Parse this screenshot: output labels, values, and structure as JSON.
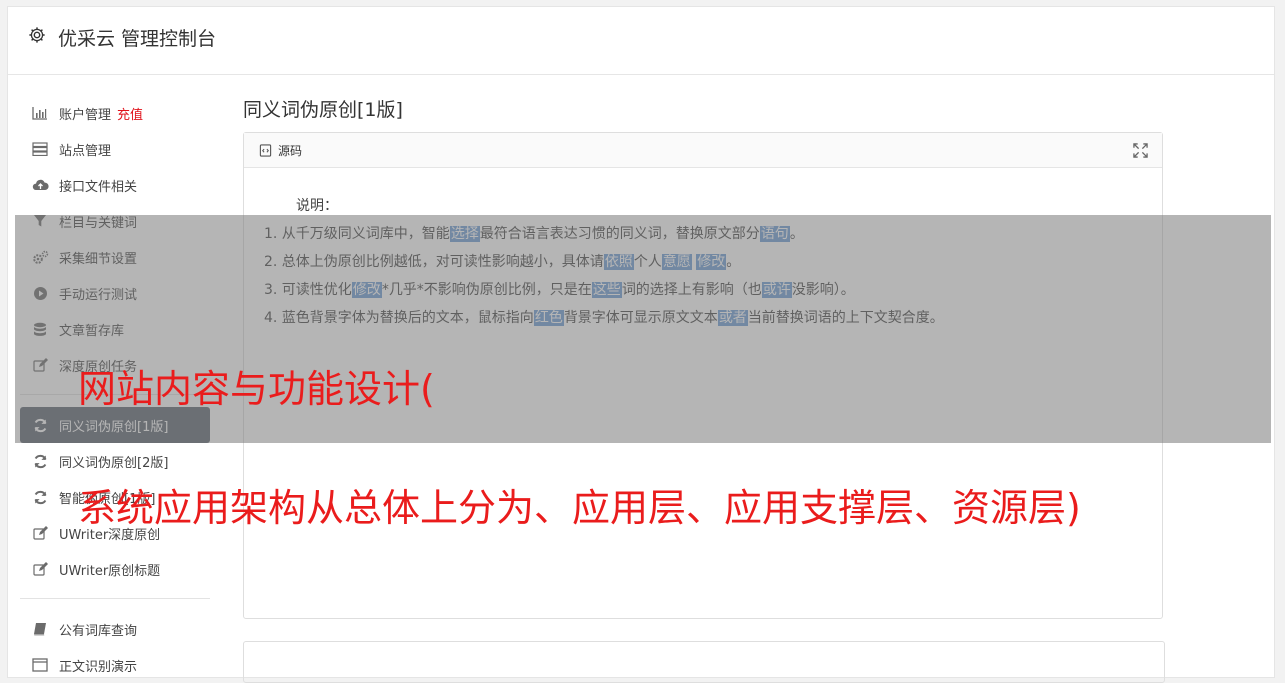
{
  "app": {
    "title": "优采云 管理控制台"
  },
  "sidebar": {
    "recharge_label": "充值",
    "group1": [
      {
        "label": "账户管理",
        "icon": "bar-chart-icon"
      },
      {
        "label": "站点管理",
        "icon": "server-icon"
      },
      {
        "label": "接口文件相关",
        "icon": "cloud-upload-icon"
      },
      {
        "label": "栏目与关键词",
        "icon": "filter-icon"
      },
      {
        "label": "采集细节设置",
        "icon": "gears-icon"
      },
      {
        "label": "手动运行测试",
        "icon": "play-circle-icon"
      },
      {
        "label": "文章暂存库",
        "icon": "database-icon"
      },
      {
        "label": "深度原创任务",
        "icon": "edit-icon"
      }
    ],
    "group2": [
      {
        "label": "同义词伪原创[1版]",
        "icon": "refresh-icon",
        "active": true
      },
      {
        "label": "同义词伪原创[2版]",
        "icon": "refresh-icon"
      },
      {
        "label": "智能伪原创[1版]",
        "icon": "refresh-icon"
      },
      {
        "label": "UWriter深度原创",
        "icon": "edit-icon"
      },
      {
        "label": "UWriter原创标题",
        "icon": "edit-icon"
      }
    ],
    "group3": [
      {
        "label": "公有词库查询",
        "icon": "book-icon"
      },
      {
        "label": "正文识别演示",
        "icon": "window-icon"
      }
    ]
  },
  "main": {
    "page_title": "同义词伪原创[1版]",
    "panel_title": "源码",
    "caption": "说明：",
    "lines": [
      [
        {
          "t": "1. 从千万级同义词库中，智能"
        },
        {
          "t": "选择",
          "hl": true
        },
        {
          "t": "最符合语言表达习惯的同义词，替换原文部分"
        },
        {
          "t": "语句",
          "hl": true
        },
        {
          "t": "。"
        }
      ],
      [
        {
          "t": "2. 总体上伪原创比例越低，对可读性影响越小，具体请"
        },
        {
          "t": "依照",
          "hl": true
        },
        {
          "t": "个人"
        },
        {
          "t": "意愿",
          "hl": true
        },
        {
          "t": " "
        },
        {
          "t": "修改",
          "hl": true
        },
        {
          "t": "。"
        }
      ],
      [
        {
          "t": "3. 可读性优化"
        },
        {
          "t": "修改",
          "hl": true
        },
        {
          "t": "*几乎*不影响伪原创比例，只是在"
        },
        {
          "t": "这些",
          "hl": true
        },
        {
          "t": "词的选择上有影响（也"
        },
        {
          "t": "或许",
          "hl": true
        },
        {
          "t": "没影响）。"
        }
      ],
      [
        {
          "t": "4. 蓝色背景字体为替换后的文本，鼠标指向"
        },
        {
          "t": "红色",
          "hl": true
        },
        {
          "t": "背景字体可显示原文文本"
        },
        {
          "t": "或者",
          "hl": true
        },
        {
          "t": "当前替换词语的上下文契合度。"
        }
      ]
    ]
  },
  "overlay": {
    "line1": "网站内容与功能设计(",
    "line2": "系统应用架构从总体上分为、应用层、应用支撑层、资源层)"
  },
  "colors": {
    "highlight": "#6b9bd4",
    "active_nav": "#5c6470",
    "overlay_text": "#ea1c1c",
    "recharge": "#e0121b"
  }
}
